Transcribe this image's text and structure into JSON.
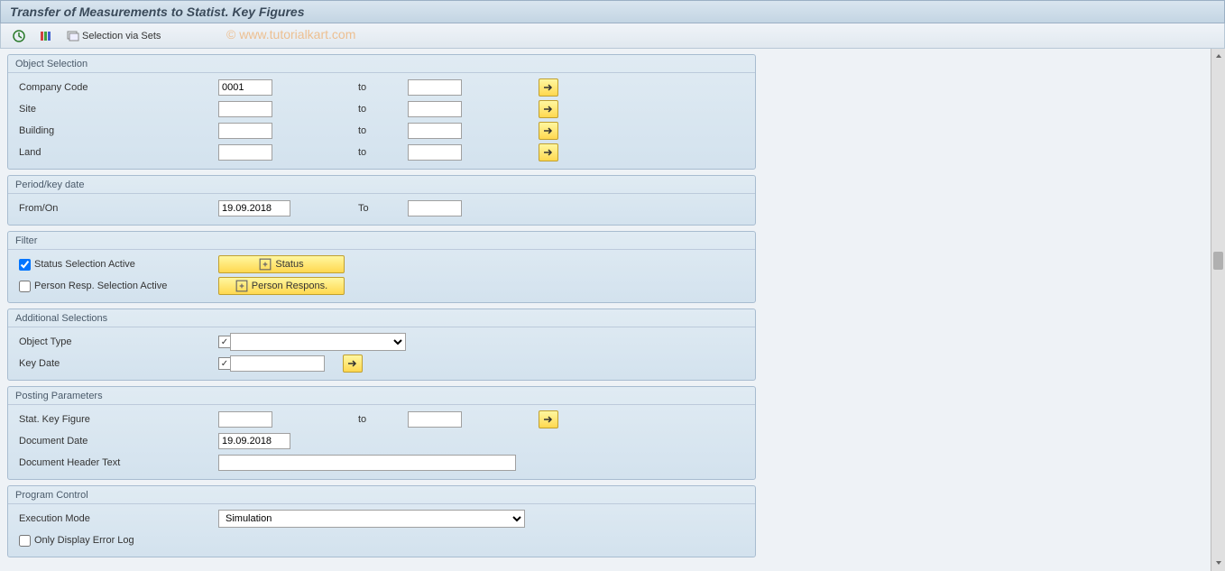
{
  "title": "Transfer of Measurements to Statist. Key Figures",
  "watermark": "© www.tutorialkart.com",
  "toolbar": {
    "selection_via_sets": "Selection via Sets"
  },
  "object_selection": {
    "header": "Object Selection",
    "company_code_label": "Company Code",
    "company_code_value": "0001",
    "site_label": "Site",
    "building_label": "Building",
    "land_label": "Land",
    "to_label": "to"
  },
  "period": {
    "header": "Period/key date",
    "from_label": "From/On",
    "from_value": "19.09.2018",
    "to_label": "To"
  },
  "filter": {
    "header": "Filter",
    "status_active_label": "Status Selection Active",
    "person_active_label": "Person Resp. Selection Active",
    "status_btn": "Status",
    "person_btn": "Person Respons."
  },
  "additional": {
    "header": "Additional Selections",
    "object_type_label": "Object Type",
    "key_date_label": "Key Date"
  },
  "posting": {
    "header": "Posting Parameters",
    "stat_key_label": "Stat. Key Figure",
    "to_label": "to",
    "doc_date_label": "Document Date",
    "doc_date_value": "19.09.2018",
    "doc_header_label": "Document Header Text"
  },
  "program_control": {
    "header": "Program Control",
    "exec_mode_label": "Execution Mode",
    "exec_mode_value": "Simulation",
    "only_error_label": "Only Display Error Log"
  }
}
